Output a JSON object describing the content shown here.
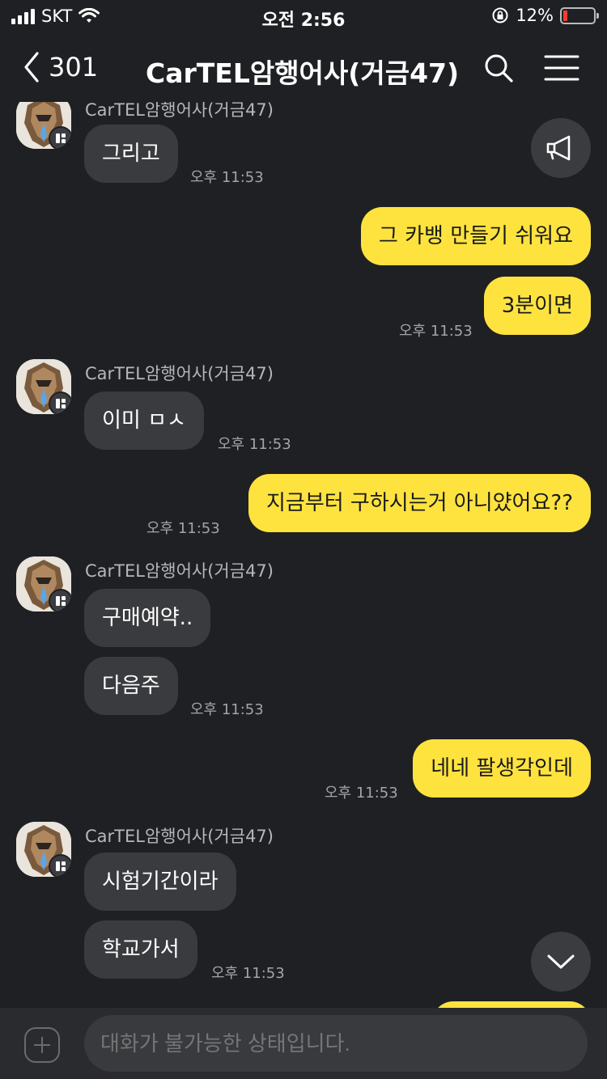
{
  "status_bar": {
    "carrier": "SKT",
    "time": "오전 2:56",
    "battery": "12%",
    "battery_level": 0.12,
    "battery_color": "#ff3b30"
  },
  "header": {
    "back_count": "301",
    "title": "CarTEL암행어사(거금47)",
    "icons": [
      "search-icon",
      "menu-icon"
    ]
  },
  "colors": {
    "background": "#1f2023",
    "incoming_bubble": "#3a3b3f",
    "outgoing_bubble": "#fee33f"
  },
  "messages": [
    {
      "sender": "CarTEL암행어사(거금47)",
      "text": "그리고",
      "time": "오후 11:53"
    },
    {
      "text": "그 카뱅 만들기 쉬워요"
    },
    {
      "text": "3분이면",
      "time": "오후 11:53"
    },
    {
      "sender": "CarTEL암행어사(거금47)",
      "text": "이미 ㅁㅅ",
      "time": "오후 11:53"
    },
    {
      "text": "지금부터 구하시는거 아니얐어요??",
      "time": "오후 11:53"
    },
    {
      "sender": "CarTEL암행어사(거금47)",
      "text": "구매예약.."
    },
    {
      "text": "다음주",
      "time": "오후 11:53"
    },
    {
      "text": "네네 팔생각인데",
      "time": "오후 11:53"
    },
    {
      "sender": "CarTEL암행어사(거금47)",
      "text": "시험기간이라"
    },
    {
      "text": "학교가서",
      "time": "오후 11:53"
    }
  ],
  "input": {
    "placeholder": "대화가 불가능한 상태입니다."
  }
}
